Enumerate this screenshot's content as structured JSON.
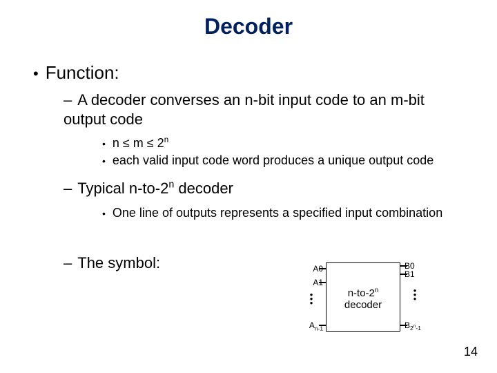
{
  "title": "Decoder",
  "heading": "Function:",
  "bullet1": "A decoder converses an n-bit input code to an m-bit output code",
  "sub1": "n ≤ m ≤  2",
  "sub1_sup": "n",
  "sub2": "each valid input code word produces a unique output code",
  "bullet2_a": "Typical n-to-2",
  "bullet2_sup": "n",
  "bullet2_b": " decoder",
  "sub3": "One line of outputs represents a specified input combination",
  "bullet3": "The symbol:",
  "diagram": {
    "label_a": "n-to-2",
    "label_sup": "n",
    "label_b": "decoder",
    "A0": "A0",
    "A1": "A1",
    "An1_a": "A",
    "An1_b": "n-1",
    "B0": "B0",
    "B1": "B1",
    "B2n1_a": "B",
    "B2n1_b": "2",
    "B2n1_sup": "n",
    "B2n1_c": "-1"
  },
  "page": "14",
  "chart_data": {
    "type": "diagram",
    "description": "Block symbol of an n-to-2^n decoder",
    "inputs": [
      "A0",
      "A1",
      "...",
      "An-1"
    ],
    "outputs": [
      "B0",
      "B1",
      "...",
      "B(2^n - 1)"
    ],
    "block_label": "n-to-2^n decoder"
  }
}
